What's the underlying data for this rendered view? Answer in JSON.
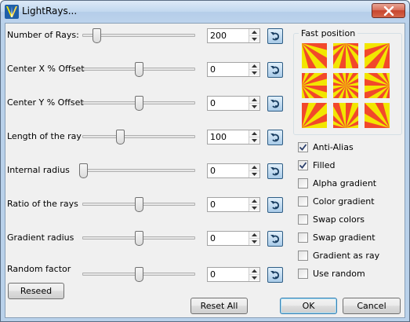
{
  "window": {
    "title": "LightRays..."
  },
  "rows": [
    {
      "label": "Number of Rays:",
      "value": "200",
      "level": 0.12
    },
    {
      "label": "Center X % Offset",
      "value": "0",
      "level": 0.5
    },
    {
      "label": "Center Y % Offset",
      "value": "0",
      "level": 0.5
    },
    {
      "label": "Length of the ray",
      "value": "100",
      "level": 0.33
    },
    {
      "label": "Internal radius",
      "value": "0",
      "level": 0.0
    },
    {
      "label": "Ratio of the rays",
      "value": "0",
      "level": 0.5
    },
    {
      "label": "Gradient radius",
      "value": "0",
      "level": 0.5
    },
    {
      "label": "Random factor",
      "value": "0",
      "level": 0.5
    }
  ],
  "fast_position": {
    "title": "Fast position"
  },
  "options": [
    {
      "label": "Anti-Alias",
      "checked": true
    },
    {
      "label": "Filled",
      "checked": true
    },
    {
      "label": "Alpha gradient",
      "checked": false
    },
    {
      "label": "Color gradient",
      "checked": false
    },
    {
      "label": "Swap colors",
      "checked": false
    },
    {
      "label": "Swap gradient",
      "checked": false
    },
    {
      "label": "Gradient as ray",
      "checked": false
    },
    {
      "label": "Use random",
      "checked": false
    }
  ],
  "buttons": {
    "reseed": "Reseed",
    "reset_all": "Reset All",
    "ok": "OK",
    "cancel": "Cancel"
  },
  "colors": {
    "ray_yellow": "#f2e600",
    "ray_red": "#f2482b",
    "window_frame": "#b9d1ea",
    "client_bg": "#f0f0f0"
  }
}
